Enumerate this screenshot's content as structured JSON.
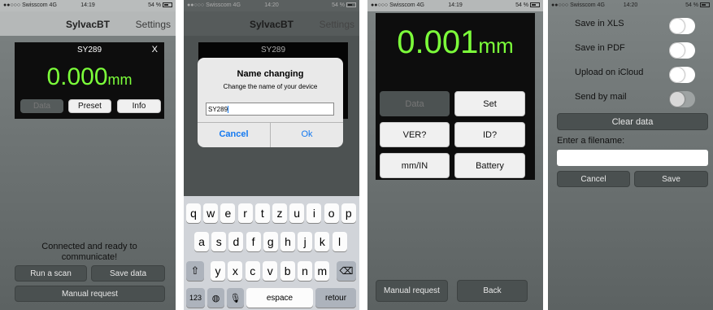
{
  "status": {
    "carrier": "●●○○○ Swisscom",
    "network": "4G",
    "time_1": "14:19",
    "time_2": "14:20",
    "time_3": "14:19",
    "time_4": "14:20",
    "battery": "54 %"
  },
  "screen1": {
    "title": "SylvacBT",
    "settings": "Settings",
    "device_name": "SY289",
    "close": "X",
    "reading_value": "0.000",
    "reading_unit": "mm",
    "tabs": [
      "Data",
      "Preset",
      "Info"
    ],
    "status_line": "Connected and ready to communicate!",
    "run_scan": "Run a scan",
    "save_data": "Save data",
    "manual_request": "Manual request"
  },
  "screen2": {
    "title": "SylvacBT",
    "settings": "Settings",
    "device_name": "SY289",
    "dialog_title": "Name changing",
    "dialog_message": "Change the name of your device",
    "input_value": "SY289",
    "cancel": "Cancel",
    "ok": "Ok",
    "keyboard_row1": [
      "q",
      "w",
      "e",
      "r",
      "t",
      "z",
      "u",
      "i",
      "o",
      "p"
    ],
    "keyboard_row2": [
      "a",
      "s",
      "d",
      "f",
      "g",
      "h",
      "j",
      "k",
      "l"
    ],
    "keyboard_row3": [
      "y",
      "x",
      "c",
      "v",
      "b",
      "n",
      "m"
    ],
    "key_123": "123",
    "key_space": "espace",
    "key_return": "retour"
  },
  "screen3": {
    "reading_value": "0.001",
    "reading_unit": "mm",
    "buttons": [
      "Data",
      "Set",
      "VER?",
      "ID?",
      "mm/IN",
      "Battery"
    ],
    "manual_request": "Manual request",
    "back": "Back"
  },
  "screen4": {
    "save_xls": "Save in XLS",
    "save_pdf": "Save in PDF",
    "upload_icloud": "Upload on iCloud",
    "send_mail": "Send by mail",
    "clear_data": "Clear data",
    "filename_label": "Enter a filename:",
    "filename_value": "",
    "cancel": "Cancel",
    "save": "Save"
  },
  "colors": {
    "lcd_green": "#7cff3a",
    "ios_blue": "#1479f0"
  }
}
